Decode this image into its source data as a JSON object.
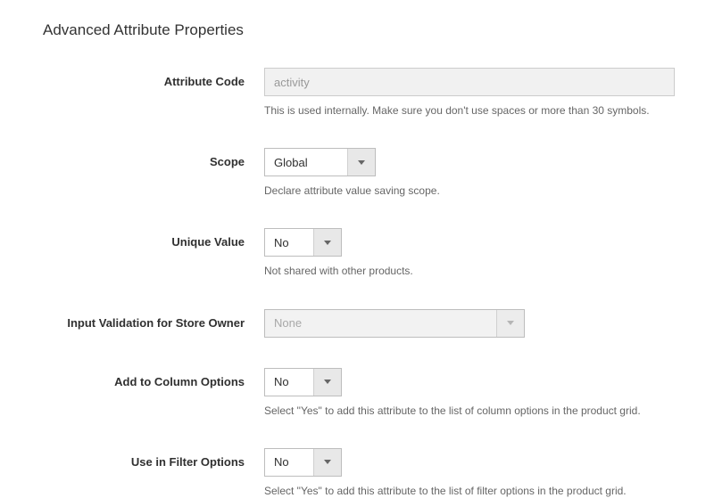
{
  "section_title": "Advanced Attribute Properties",
  "fields": {
    "attribute_code": {
      "label": "Attribute Code",
      "value": "activity",
      "hint": "This is used internally. Make sure you don't use spaces or more than 30 symbols."
    },
    "scope": {
      "label": "Scope",
      "value": "Global",
      "hint": "Declare attribute value saving scope."
    },
    "unique_value": {
      "label": "Unique Value",
      "value": "No",
      "hint": "Not shared with other products."
    },
    "input_validation": {
      "label": "Input Validation for Store Owner",
      "value": "None"
    },
    "add_to_column": {
      "label": "Add to Column Options",
      "value": "No",
      "hint": "Select \"Yes\" to add this attribute to the list of column options in the product grid."
    },
    "use_in_filter": {
      "label": "Use in Filter Options",
      "value": "No",
      "hint": "Select \"Yes\" to add this attribute to the list of filter options in the product grid."
    }
  }
}
